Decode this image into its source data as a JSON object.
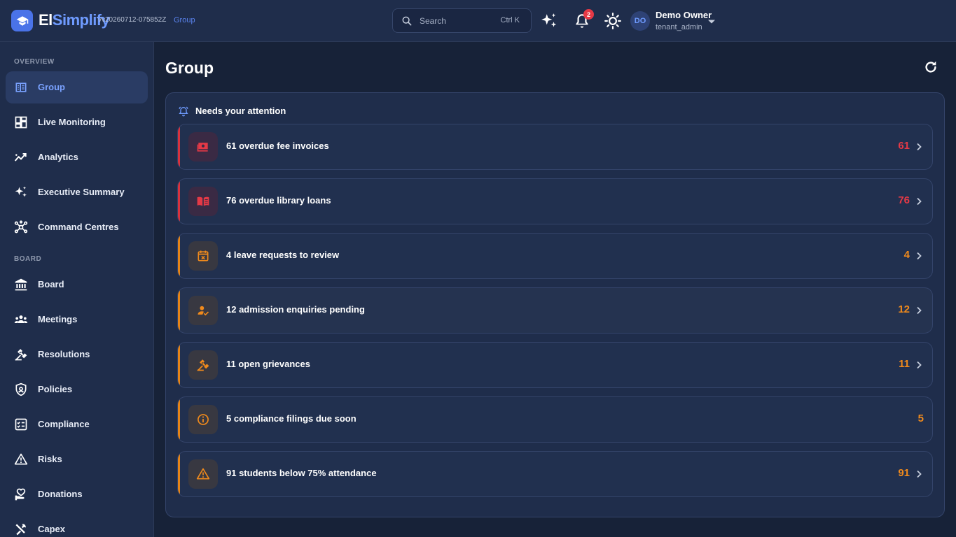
{
  "app": {
    "brand_part1": "El",
    "brand_part2": "Simplify",
    "version": "vv20260712-075852Z",
    "breadcrumb": "Group",
    "logo_icon": "graduation-cap-icon"
  },
  "topbar": {
    "search_placeholder": "Search",
    "search_shortcut": "Ctrl K",
    "notifications_count": "2",
    "user_initials": "DO",
    "user_name": "Demo Owner",
    "user_role": "tenant_admin"
  },
  "sidebar": {
    "sections": [
      {
        "title": "OVERVIEW",
        "items": [
          {
            "label": "Group",
            "icon": "building-icon",
            "active": true
          },
          {
            "label": "Live Monitoring",
            "icon": "dashboard-icon"
          },
          {
            "label": "Analytics",
            "icon": "trending-icon"
          },
          {
            "label": "Executive Summary",
            "icon": "sparkle-icon"
          },
          {
            "label": "Command Centres",
            "icon": "hub-icon"
          }
        ]
      },
      {
        "title": "BOARD",
        "items": [
          {
            "label": "Board",
            "icon": "bank-icon"
          },
          {
            "label": "Meetings",
            "icon": "people-icon"
          },
          {
            "label": "Resolutions",
            "icon": "gavel-icon"
          },
          {
            "label": "Policies",
            "icon": "shield-icon"
          },
          {
            "label": "Compliance",
            "icon": "checklist-icon"
          },
          {
            "label": "Risks",
            "icon": "warning-icon"
          },
          {
            "label": "Donations",
            "icon": "heart-hand-icon"
          },
          {
            "label": "Capex",
            "icon": "tools-icon"
          }
        ]
      }
    ]
  },
  "main": {
    "title": "Group",
    "attention_title": "Needs your attention",
    "items": [
      {
        "label": "61 overdue fee invoices",
        "count": "61",
        "severity": "high",
        "icon": "payment-icon"
      },
      {
        "label": "76 overdue library loans",
        "count": "76",
        "severity": "high",
        "icon": "book-icon"
      },
      {
        "label": "4 leave requests to review",
        "count": "4",
        "severity": "medium",
        "icon": "calendar-x-icon"
      },
      {
        "label": "12 admission enquiries pending",
        "count": "12",
        "severity": "medium",
        "icon": "person-check-icon"
      },
      {
        "label": "11 open grievances",
        "count": "11",
        "severity": "medium",
        "icon": "gavel-icon"
      },
      {
        "label": "5 compliance filings due soon",
        "count": "5",
        "severity": "medium",
        "icon": "info-icon"
      },
      {
        "label": "91 students below 75% attendance",
        "count": "91",
        "severity": "medium",
        "icon": "warning-icon"
      }
    ]
  },
  "colors": {
    "accent": "#4a73e8",
    "high": "#e53946",
    "medium": "#f08a1c"
  }
}
